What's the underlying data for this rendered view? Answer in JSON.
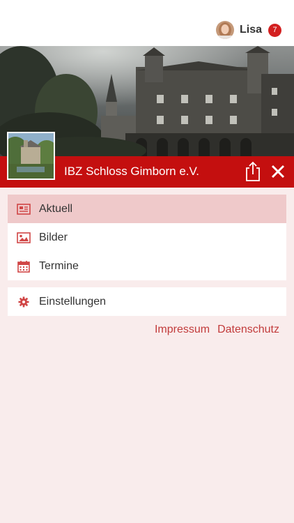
{
  "header": {
    "user_name": "Lisa",
    "notification_count": "7"
  },
  "org": {
    "name": "IBZ Schloss Gimborn e.V."
  },
  "menu": {
    "items": [
      {
        "label": "Aktuell",
        "icon": "newspaper-icon",
        "active": true
      },
      {
        "label": "Bilder",
        "icon": "image-icon",
        "active": false
      },
      {
        "label": "Termine",
        "icon": "calendar-icon",
        "active": false
      }
    ],
    "settings": {
      "label": "Einstellungen",
      "icon": "gear-icon"
    }
  },
  "footer_links": {
    "impressum": "Impressum",
    "datenschutz": "Datenschutz"
  },
  "colors": {
    "accent": "#c40f0f",
    "accent_light": "#efc9ca",
    "background": "#f9ecec",
    "link": "#c23b3b"
  }
}
